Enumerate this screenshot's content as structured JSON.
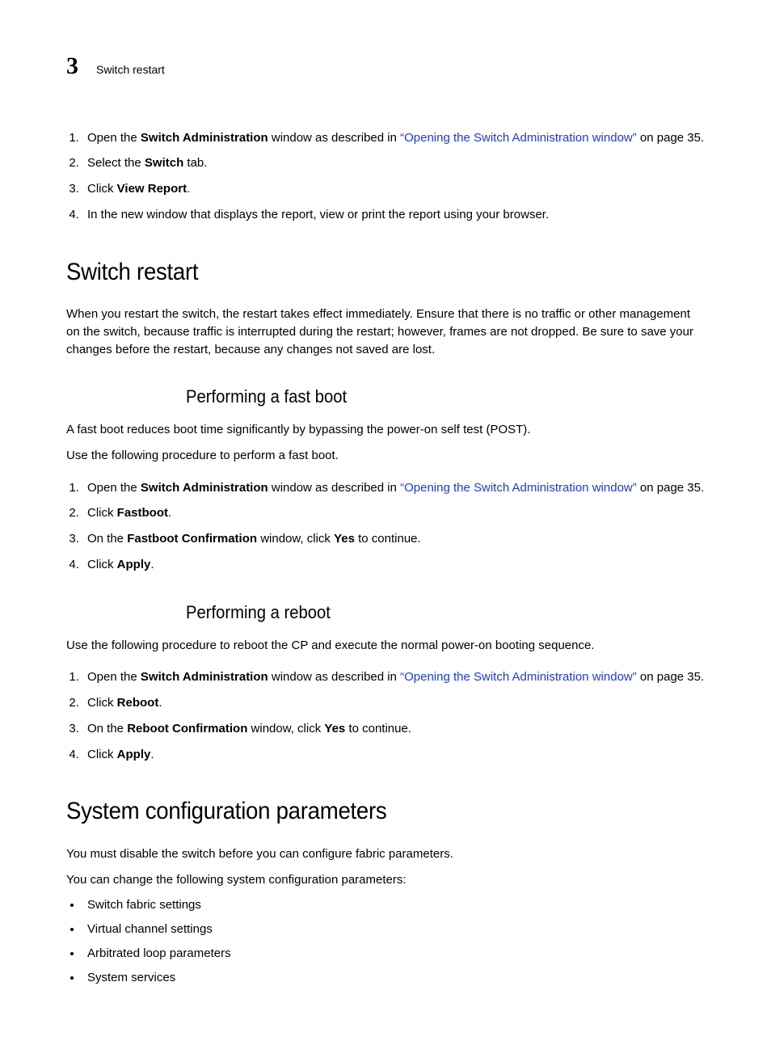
{
  "header": {
    "chapter_number": "3",
    "running_title": "Switch restart"
  },
  "intro_steps": {
    "s1_pre": "Open the ",
    "s1_bold": "Switch Administration",
    "s1_mid": " window as described in ",
    "s1_link": "“Opening the Switch Administration window”",
    "s1_post": " on page 35.",
    "s2_pre": "Select the ",
    "s2_bold": "Switch",
    "s2_post": " tab.",
    "s3_pre": "Click ",
    "s3_bold": "View Report",
    "s3_post": ".",
    "s4": "In the new window that displays the report, view or print the report using your browser."
  },
  "switch_restart": {
    "title": "Switch restart",
    "para": "When you restart the switch, the restart takes effect immediately. Ensure that there is no traffic or other management on the switch, because traffic is interrupted during the restart; however, frames are not dropped. Be sure to save your changes before the restart, because any changes not saved are lost."
  },
  "fast_boot": {
    "title": "Performing a fast boot",
    "p1": "A fast boot reduces boot time significantly by bypassing the power-on self test (POST).",
    "p2": "Use the following procedure to perform a fast boot.",
    "s1_pre": "Open the ",
    "s1_bold": "Switch Administration",
    "s1_mid": " window as described in ",
    "s1_link": "“Opening the Switch Administration window”",
    "s1_post": " on page 35.",
    "s2_pre": "Click ",
    "s2_bold": "Fastboot",
    "s2_post": ".",
    "s3_pre": "On the ",
    "s3_bold1": "Fastboot Confirmation",
    "s3_mid": " window, click ",
    "s3_bold2": "Yes",
    "s3_post": " to continue.",
    "s4_pre": "Click ",
    "s4_bold": "Apply",
    "s4_post": "."
  },
  "reboot": {
    "title": "Performing a reboot",
    "p1": "Use the following procedure to reboot the CP and execute the normal power-on booting sequence.",
    "s1_pre": "Open the ",
    "s1_bold": "Switch Administration",
    "s1_mid": " window as described in ",
    "s1_link": "“Opening the Switch Administration window”",
    "s1_post": " on page 35.",
    "s2_pre": "Click ",
    "s2_bold": "Reboot",
    "s2_post": ".",
    "s3_pre": "On the ",
    "s3_bold1": "Reboot Confirmation",
    "s3_mid": " window, click ",
    "s3_bold2": "Yes",
    "s3_post": " to continue.",
    "s4_pre": "Click ",
    "s4_bold": "Apply",
    "s4_post": "."
  },
  "sysconfig": {
    "title": "System configuration parameters",
    "p1": "You must disable the switch before you can configure fabric parameters.",
    "p2": "You can change the following system configuration parameters:",
    "b1": "Switch fabric settings",
    "b2": "Virtual channel settings",
    "b3": "Arbitrated loop parameters",
    "b4": "System services"
  }
}
